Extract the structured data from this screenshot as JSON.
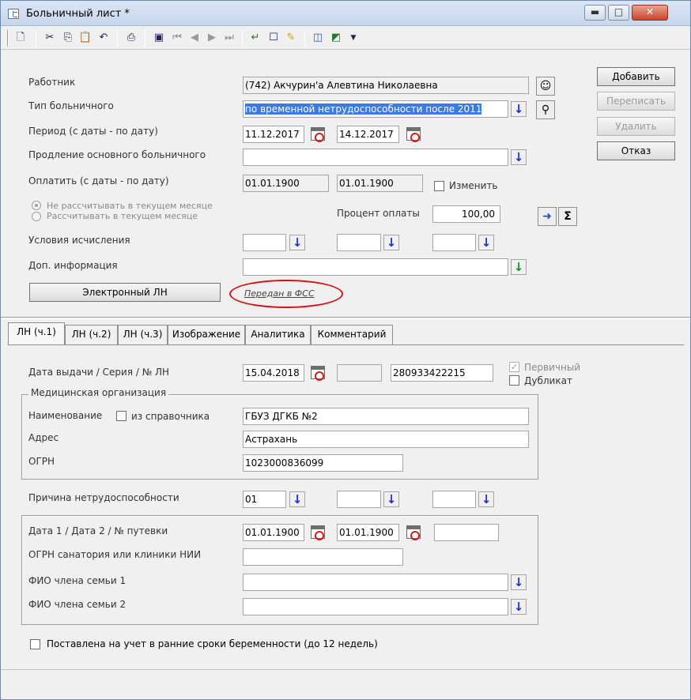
{
  "window": {
    "title": "Больничный лист *",
    "minimize": "▬",
    "maximize": "□",
    "close": "✕"
  },
  "toolbar": {
    "icons": [
      "new-document-icon",
      "cut-icon",
      "copy-icon",
      "paste-icon",
      "undo-icon",
      "print-icon",
      "save-icon",
      "first-record-icon",
      "prev-record-icon",
      "next-record-icon",
      "last-record-icon",
      "refresh-icon",
      "close-record-icon",
      "tag-icon",
      "filter-icon",
      "chart-icon",
      "dropdown-arrow-icon"
    ]
  },
  "form": {
    "worker_label": "Работник",
    "worker_value": "(742) Акчурин'а Алевтина Николаевна",
    "type_label": "Тип больничного",
    "type_value": "по временной нетрудоспособности после 2011",
    "period_label": "Период (с даты - по дату)",
    "period_from": "11.12.2017",
    "period_to": "14.12.2017",
    "extension_label": "Продление основного больничного",
    "extension_value": "",
    "pay_label": "Оплатить (с даты - по дату)",
    "pay_from": "01.01.1900",
    "pay_to": "01.01.1900",
    "change_label": "Изменить",
    "radio1_label": "Не рассчитывать в текущем месяце",
    "radio2_label": "Рассчитывать в текущем месяце",
    "percent_label": "Процент оплаты",
    "percent_value": "100,00",
    "conditions_label": "Условия исчисления",
    "info_label": "Доп. информация",
    "info_value": "",
    "eln_button": "Электронный ЛН",
    "fss_link": "Передан в ФСС",
    "sigma": "Σ"
  },
  "side_buttons": {
    "add": "Добавить",
    "rewrite": "Переписать",
    "delete": "Удалить",
    "cancel": "Отказ"
  },
  "tabs": [
    "ЛН (ч.1)",
    "ЛН (ч.2)",
    "ЛН (ч.3)",
    "Изображение",
    "Аналитика",
    "Комментарий"
  ],
  "tab1": {
    "issue_label": "Дата выдачи / Серия / № ЛН",
    "issue_date": "15.04.2018",
    "series": "",
    "number": "280933422215",
    "primary_label": "Первичный",
    "duplicate_label": "Дубликат",
    "med_group": "Медицинская организация",
    "name_label": "Наименование",
    "from_dir_label": "из справочника",
    "name_value": "ГБУЗ ДГКБ №2",
    "address_label": "Адрес",
    "address_value": "Астрахань",
    "ogrn_label": "ОГРН",
    "ogrn_value": "1023000836099",
    "reason_label": "Причина нетрудоспособности",
    "reason_value": "01",
    "dates_label": "Дата 1 / Дата 2 / № путевки",
    "date1": "01.01.1900",
    "date2": "01.01.1900",
    "voucher": "",
    "sanatorium_label": "ОГРН санатория или клиники НИИ",
    "family1_label": "ФИО члена семьи 1",
    "family2_label": "ФИО члена семьи 2",
    "pregnancy_label": "Поставлена на учет в ранние сроки беременности (до 12 недель)"
  }
}
